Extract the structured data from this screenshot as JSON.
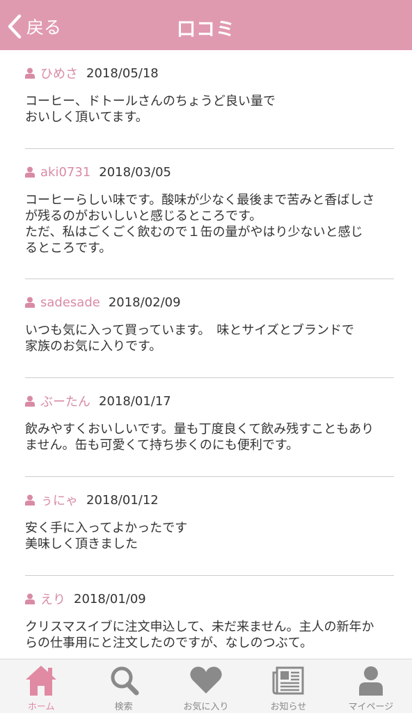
{
  "header": {
    "back_label": "戻る",
    "title": "口コミ"
  },
  "reviews": [
    {
      "author": "ひめさ",
      "date": "2018/05/18",
      "body": "コーヒー、ドトールさんのちょうど良い量で\nおいしく頂いてます。"
    },
    {
      "author": "aki0731",
      "date": "2018/03/05",
      "body": "コーヒーらしい味です。酸味が少なく最後まで苦みと香ばしさ\nが残るのがおいしいと感じるところです。\nただ、私はごくごく飲むので１缶の量がやはり少ないと感じ\nるところです。"
    },
    {
      "author": "sadesade",
      "date": "2018/02/09",
      "body": "いつも気に入って買っています。　味とサイズとブランドで\n家族のお気に入りです。"
    },
    {
      "author": "ぶーたん",
      "date": "2018/01/17",
      "body": "飲みやすくおいしいです。量も丁度良くて飲み残すこともあり\nません。缶も可愛くて持ち歩くのにも便利です。"
    },
    {
      "author": "ぅにゃ",
      "date": "2018/01/12",
      "body": "安く手に入ってよかったです\n美味しく頂きました"
    },
    {
      "author": "えり",
      "date": "2018/01/09",
      "body": "クリスマスイブに注文申込して、未だ来ません。主人の新年か\nらの仕事用にと注文したのですが、なしのつぶて。"
    }
  ],
  "tabbar": {
    "items": [
      {
        "label": "ホーム",
        "icon": "home-icon",
        "active": true
      },
      {
        "label": "検索",
        "icon": "search-icon",
        "active": false
      },
      {
        "label": "お気に入り",
        "icon": "heart-icon",
        "active": false
      },
      {
        "label": "お知らせ",
        "icon": "newspaper-icon",
        "active": false
      },
      {
        "label": "マイページ",
        "icon": "person-icon",
        "active": false
      }
    ]
  },
  "colors": {
    "accent": "#e09ab0",
    "author": "#d98ba4",
    "active_tab": "#e08aa4",
    "inactive_tab": "#8a8a8a"
  }
}
